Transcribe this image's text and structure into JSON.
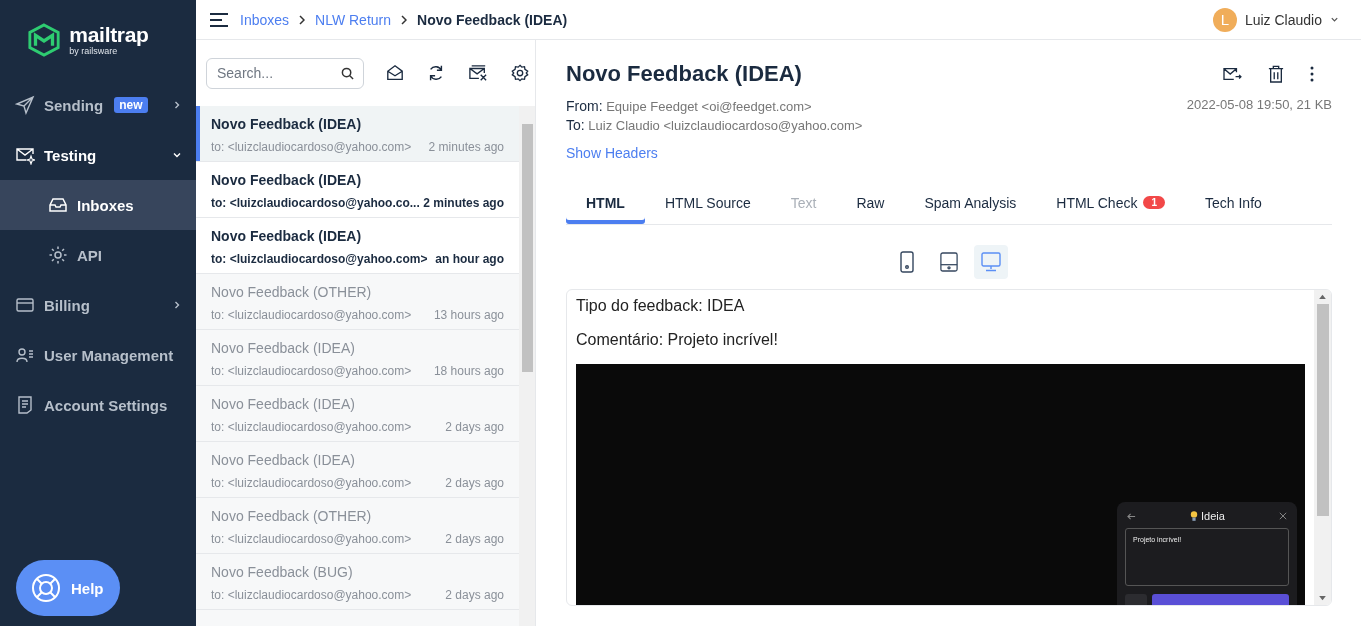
{
  "sidebar": {
    "logo": {
      "name": "mailtrap",
      "tagline": "by railsware"
    },
    "nav": [
      {
        "label": "Sending",
        "badge": "new",
        "kind": "group",
        "expanded": false,
        "selected": false
      },
      {
        "label": "Testing",
        "kind": "group",
        "expanded": true,
        "selected": false,
        "children": [
          {
            "label": "Inboxes",
            "selected": true
          },
          {
            "label": "API",
            "selected": false
          }
        ]
      },
      {
        "label": "Billing",
        "kind": "group",
        "expanded": false,
        "selected": false
      },
      {
        "label": "User Management",
        "kind": "link",
        "expanded": false,
        "selected": false
      },
      {
        "label": "Account Settings",
        "kind": "link",
        "expanded": false,
        "selected": false
      }
    ],
    "help_button": "Help"
  },
  "topbar": {
    "breadcrumb": [
      "Inboxes",
      "NLW Return",
      "Novo Feedback (IDEA)"
    ],
    "user": {
      "initial": "L",
      "name": "Luiz Claudio"
    }
  },
  "message_list": {
    "search": {
      "placeholder": "Search..."
    },
    "messages": [
      {
        "subject": "Novo Feedback (IDEA)",
        "to": "to: <luizclaudiocardoso@yahoo.com>",
        "time": "2 minutes ago",
        "selected": true,
        "unread": false
      },
      {
        "subject": "Novo Feedback (IDEA)",
        "to": "to: <luizclaudiocardoso@yahoo.co...",
        "time": "2 minutes ago",
        "selected": false,
        "unread": true
      },
      {
        "subject": "Novo Feedback (IDEA)",
        "to": "to: <luizclaudiocardoso@yahoo.com>",
        "time": "an hour ago",
        "selected": false,
        "unread": true
      },
      {
        "subject": "Novo Feedback (OTHER)",
        "to": "to: <luizclaudiocardoso@yahoo.com>",
        "time": "13 hours ago",
        "selected": false,
        "unread": false
      },
      {
        "subject": "Novo Feedback (IDEA)",
        "to": "to: <luizclaudiocardoso@yahoo.com>",
        "time": "18 hours ago",
        "selected": false,
        "unread": false
      },
      {
        "subject": "Novo Feedback (IDEA)",
        "to": "to: <luizclaudiocardoso@yahoo.com>",
        "time": "2 days ago",
        "selected": false,
        "unread": false
      },
      {
        "subject": "Novo Feedback (IDEA)",
        "to": "to: <luizclaudiocardoso@yahoo.com>",
        "time": "2 days ago",
        "selected": false,
        "unread": false
      },
      {
        "subject": "Novo Feedback (OTHER)",
        "to": "to: <luizclaudiocardoso@yahoo.com>",
        "time": "2 days ago",
        "selected": false,
        "unread": false
      },
      {
        "subject": "Novo Feedback (BUG)",
        "to": "to: <luizclaudiocardoso@yahoo.com>",
        "time": "2 days ago",
        "selected": false,
        "unread": false
      }
    ]
  },
  "message": {
    "subject": "Novo Feedback (IDEA)",
    "from_label": "From:",
    "from": "Equipe Feedget <oi@feedget.com>",
    "to_label": "To:",
    "to": "Luiz Claudio <luizclaudiocardoso@yahoo.com>",
    "meta": "2022-05-08 19:50, 21 KB",
    "show_headers": "Show Headers",
    "tabs": [
      {
        "label": "HTML",
        "selected": true,
        "disabled": false
      },
      {
        "label": "HTML Source",
        "selected": false,
        "disabled": false
      },
      {
        "label": "Text",
        "selected": false,
        "disabled": true
      },
      {
        "label": "Raw",
        "selected": false,
        "disabled": false
      },
      {
        "label": "Spam Analysis",
        "selected": false,
        "disabled": false
      },
      {
        "label": "HTML Check",
        "selected": false,
        "disabled": false,
        "badge": "1"
      },
      {
        "label": "Tech Info",
        "selected": false,
        "disabled": false
      }
    ],
    "devices": [
      {
        "kind": "phone",
        "selected": false
      },
      {
        "kind": "tablet",
        "selected": false
      },
      {
        "kind": "desktop",
        "selected": true
      }
    ],
    "preview": {
      "lines": [
        "Tipo do feedback: IDEA",
        "Comentário: Projeto incrível!"
      ],
      "screenshot": {
        "title": "Ideia",
        "text": "Projeto incrível!"
      }
    }
  }
}
